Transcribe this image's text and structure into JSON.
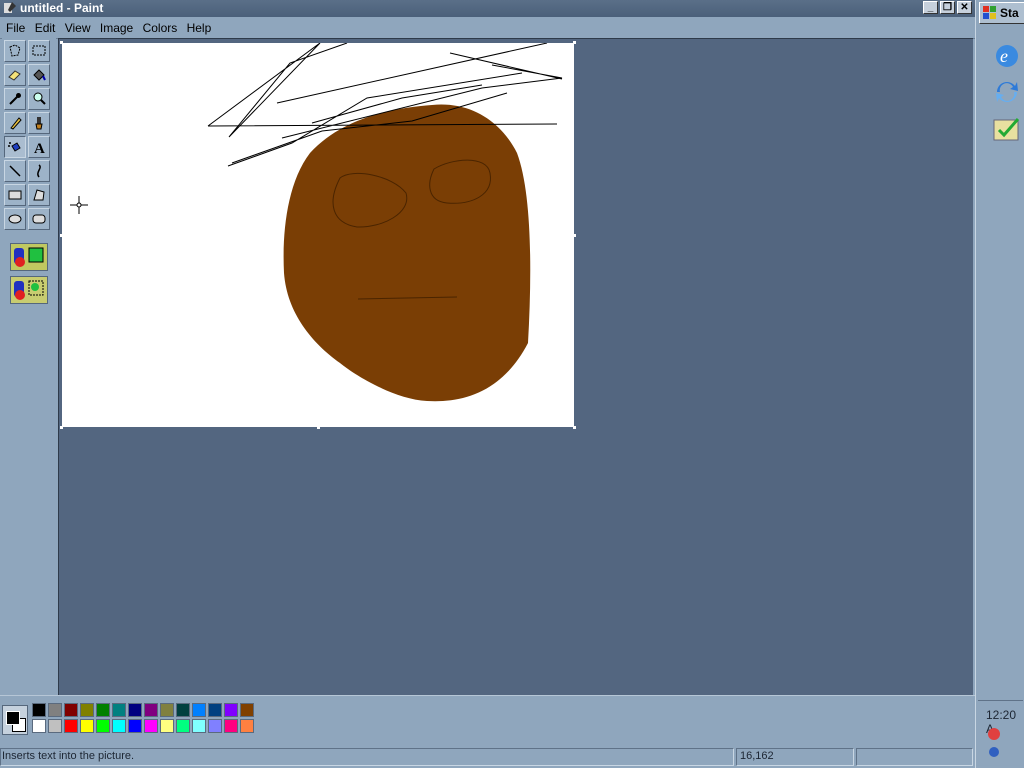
{
  "window": {
    "title": "untitled - Paint",
    "buttons": {
      "minimize": "_",
      "restore": "❐",
      "close": "✕"
    }
  },
  "menu": [
    "File",
    "Edit",
    "View",
    "Image",
    "Colors",
    "Help"
  ],
  "toolbox": {
    "tools": [
      {
        "name": "free-form-select-icon"
      },
      {
        "name": "select-icon"
      },
      {
        "name": "eraser-icon"
      },
      {
        "name": "fill-with-color-icon"
      },
      {
        "name": "pick-color-icon"
      },
      {
        "name": "magnifier-icon"
      },
      {
        "name": "pencil-icon"
      },
      {
        "name": "brush-icon"
      },
      {
        "name": "airbrush-icon"
      },
      {
        "name": "text-icon",
        "glyph": "A",
        "active": true
      },
      {
        "name": "line-icon"
      },
      {
        "name": "curve-icon"
      },
      {
        "name": "rectangle-icon"
      },
      {
        "name": "polygon-icon"
      },
      {
        "name": "ellipse-icon"
      },
      {
        "name": "rounded-rectangle-icon"
      }
    ]
  },
  "palette": {
    "top": [
      "#000000",
      "#808080",
      "#800000",
      "#808000",
      "#008000",
      "#008080",
      "#000080",
      "#800080",
      "#808040",
      "#004040",
      "#0080ff",
      "#004080",
      "#8000ff",
      "#804000"
    ],
    "bottom": [
      "#ffffff",
      "#c0c0c0",
      "#ff0000",
      "#ffff00",
      "#00ff00",
      "#00ffff",
      "#0000ff",
      "#ff00ff",
      "#ffff80",
      "#00ff80",
      "#80ffff",
      "#8080ff",
      "#ff0080",
      "#ff8040"
    ],
    "foreground": "#000000",
    "background": "#ffffff"
  },
  "status": {
    "text": "Inserts text into the picture.",
    "coords": "16,162"
  },
  "drawing": {
    "face_color": "#7a3e05"
  },
  "taskbar": {
    "start_label": "Sta",
    "clock": "12:20 A"
  }
}
